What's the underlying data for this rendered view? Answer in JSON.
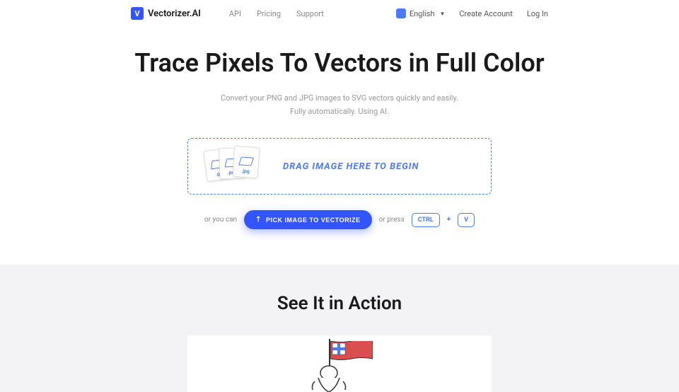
{
  "brand": "Vectorizer.AI",
  "nav": {
    "api": "API",
    "pricing": "Pricing",
    "support": "Support"
  },
  "lang": "English",
  "auth": {
    "create": "Create Account",
    "login": "Log In"
  },
  "hero": {
    "title": "Trace Pixels To Vectors in Full Color",
    "sub1": "Convert your PNG and JPG images to SVG vectors quickly and easily.",
    "sub2": "Fully automatically. Using AI."
  },
  "drop": {
    "ext1": ".gif",
    "ext2": ".png",
    "ext3": ".jpg",
    "text": "DRAG IMAGE HERE TO BEGIN"
  },
  "actions": {
    "or1": "or you can",
    "pick": "PICK IMAGE TO VECTORIZE",
    "or2": "or press",
    "k1": "CTRL",
    "plus": "+",
    "k2": "V"
  },
  "section2": {
    "title": "See It in Action"
  }
}
